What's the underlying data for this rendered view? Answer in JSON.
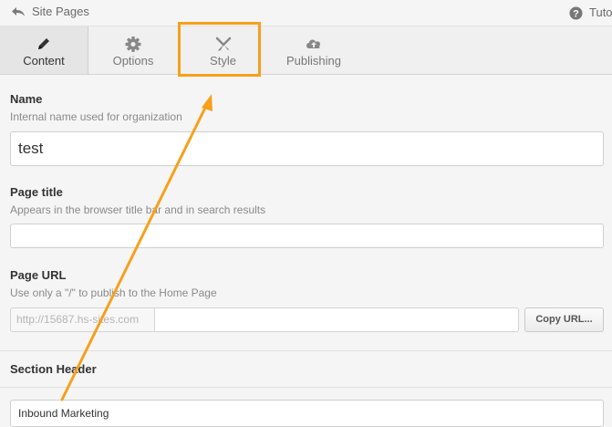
{
  "topbar": {
    "title": "Site Pages",
    "help_label": "Tutorial",
    "back_icon": "back-arrow-icon",
    "help_icon": "question-circle-icon"
  },
  "tabs": [
    {
      "label": "Content",
      "icon": "pencil-icon",
      "active": true
    },
    {
      "label": "Options",
      "icon": "gear-icon",
      "active": false
    },
    {
      "label": "Style",
      "icon": "brush-icon",
      "active": false
    },
    {
      "label": "Publishing",
      "icon": "cloud-upload-icon",
      "active": false
    }
  ],
  "form": {
    "name": {
      "label": "Name",
      "help": "Internal name used for organization",
      "value": "test"
    },
    "page_title": {
      "label": "Page title",
      "help": "Appears in the browser title bar and in search results",
      "value": ""
    },
    "page_url": {
      "label": "Page URL",
      "help": "Use only a \"/\" to publish to the Home Page",
      "prefix": "http://15687.hs-sites.com",
      "value": "",
      "copy_button": "Copy URL..."
    }
  },
  "section": {
    "header": "Section Header",
    "value": "Inbound Marketing"
  },
  "colors": {
    "annotation": "#f7a01c",
    "background": "#f5f5f5"
  }
}
